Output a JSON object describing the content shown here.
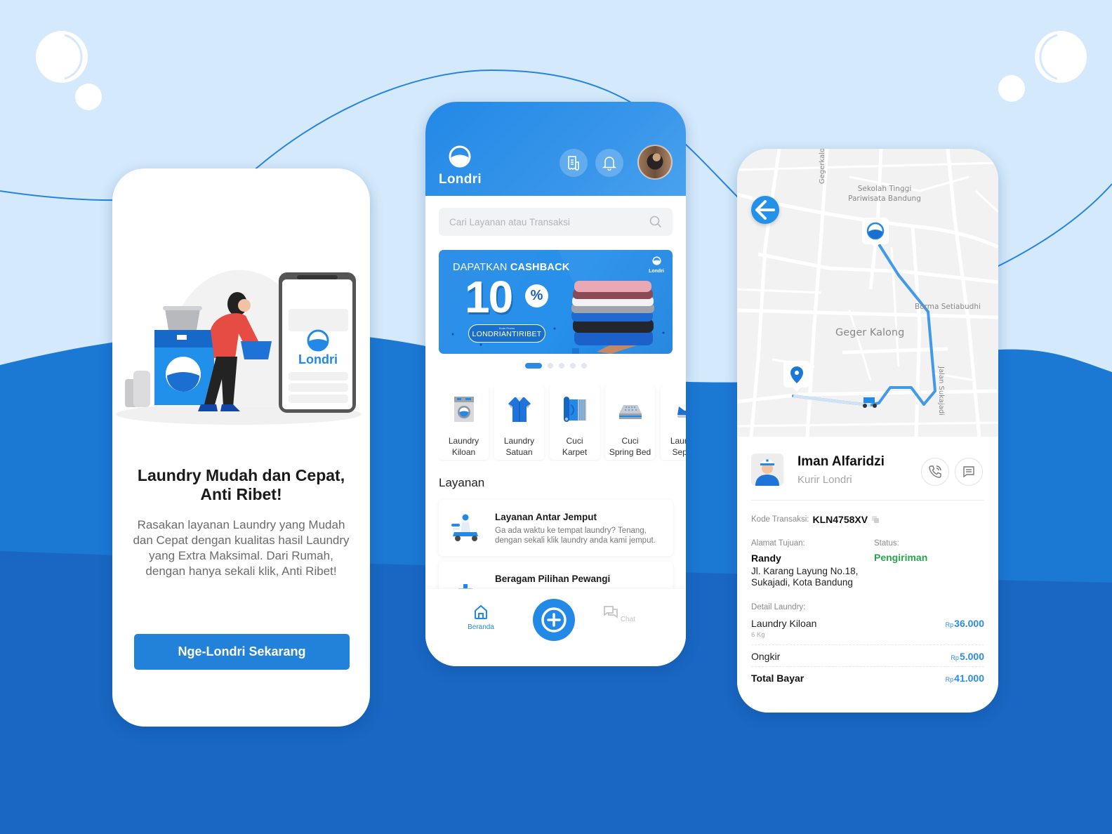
{
  "colors": {
    "primary": "#2389e6",
    "background_light": "#d4e9fb",
    "background_dark": "#1967c2",
    "status_green": "#26a64a"
  },
  "onboarding": {
    "illustration_brand": "Londri",
    "title": "Laundry Mudah dan Cepat, Anti Ribet!",
    "description": "Rasakan layanan Laundry yang Mudah dan Cepat dengan kualitas hasil Laundry yang Extra Maksimal. Dari Rumah, dengan hanya sekali klik, Anti Ribet!",
    "cta_label": "Nge-Londri Sekarang"
  },
  "home": {
    "brand": "Londri",
    "header_icons": [
      "receipt-icon",
      "bell-icon",
      "profile-avatar"
    ],
    "search": {
      "placeholder": "Cari Layanan atau Transaksi",
      "value": ""
    },
    "banner": {
      "title_prefix": "DAPATKAN",
      "title_bold": "CASHBACK",
      "amount": "10",
      "percent": "%",
      "promo_label": "Kode Promo",
      "promo_code": "LONDRIANTIRIBET",
      "brand": "Londri"
    },
    "carousel": {
      "total": 5,
      "active": 1
    },
    "categories": [
      {
        "line1": "Laundry",
        "line2": "Kiloan",
        "icon": "washing-machine-icon"
      },
      {
        "line1": "Laundry",
        "line2": "Satuan",
        "icon": "shirt-icon"
      },
      {
        "line1": "Cuci",
        "line2": "Karpet",
        "icon": "carpet-icon"
      },
      {
        "line1": "Cuci",
        "line2": "Spring Bed",
        "icon": "mattress-icon"
      },
      {
        "line1": "Laundry",
        "line2": "Sepatu",
        "icon": "shoe-icon"
      }
    ],
    "services_title": "Layanan",
    "services": [
      {
        "title": "Layanan Antar Jemput",
        "desc": "Ga ada waktu ke tempat laundry? Tenang, dengan sekali klik laundry anda kami jemput.",
        "icon": "delivery-scooter-icon"
      },
      {
        "title": "Beragam Pilihan Pewangi",
        "desc": "",
        "icon": "perfume-icon"
      }
    ],
    "nav": {
      "home_label": "Beranda",
      "chat_label": "Chat",
      "active": "Beranda"
    }
  },
  "tracking": {
    "map_labels": {
      "street_1": "Gegerkalong",
      "poi_1": "Sekolah Tinggi Pariwisata Bandung",
      "poi_2": "Borma Setiabudhi",
      "area": "Geger Kalong",
      "street_2": "Jalan Sukajadi"
    },
    "courier": {
      "name": "Iman Alfaridzi",
      "role": "Kurir Londri"
    },
    "transaction_code_label": "Kode Transaksi:",
    "transaction_code": "KLN4758XV",
    "address_label": "Alamat Tujuan:",
    "recipient": "Randy",
    "address": "Jl. Karang Layung No.18, Sukajadi, Kota Bandung",
    "status_label": "Status:",
    "status": "Pengiriman",
    "detail_label": "Detail Laundry:",
    "currency": "Rp",
    "items": [
      {
        "name": "Laundry Kiloan",
        "sub": "6 Kg",
        "price": "36.000"
      },
      {
        "name": "Ongkir",
        "sub": "",
        "price": "5.000"
      }
    ],
    "total_label": "Total Bayar",
    "total": "41.000"
  }
}
